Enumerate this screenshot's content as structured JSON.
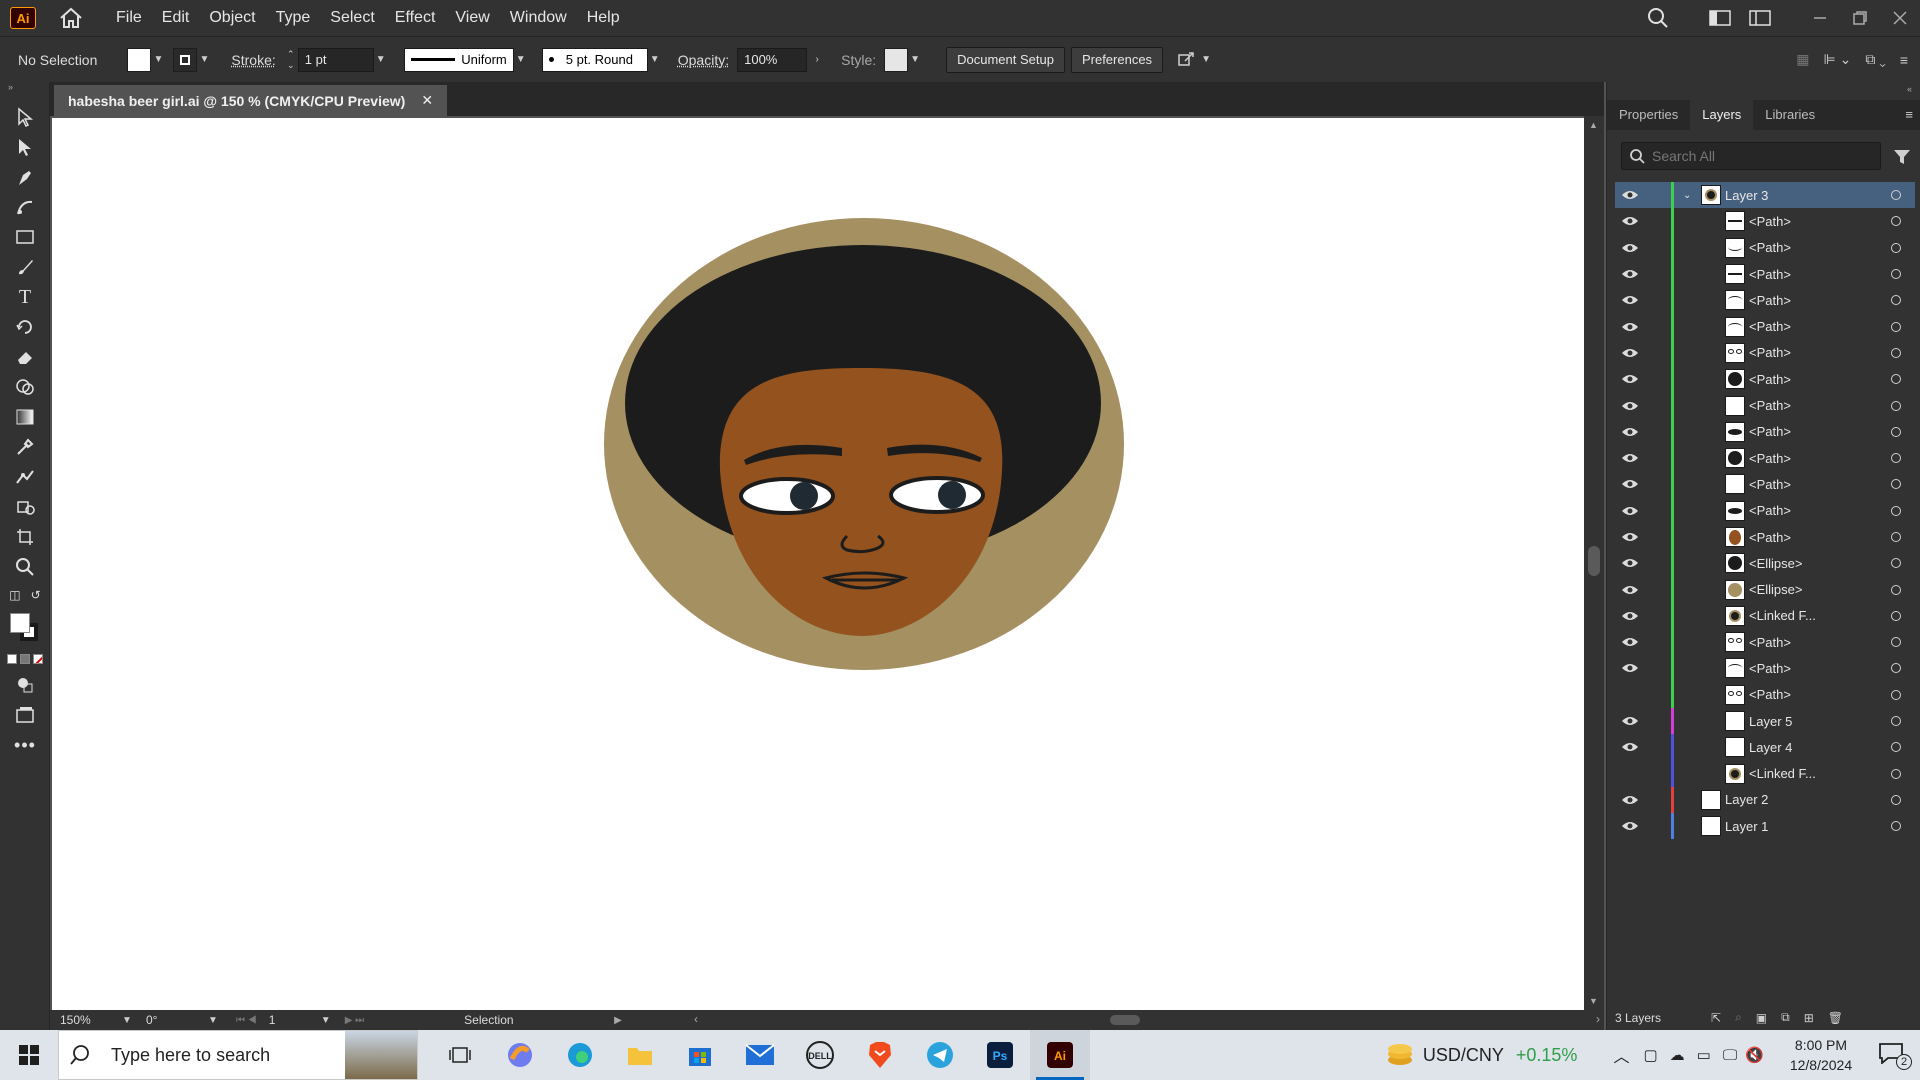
{
  "app": {
    "logo_text": "Ai",
    "accent": "#ff9a00"
  },
  "menu": {
    "items": [
      "File",
      "Edit",
      "Object",
      "Type",
      "Select",
      "Effect",
      "View",
      "Window",
      "Help"
    ]
  },
  "control": {
    "selection": "No Selection",
    "stroke_label": "Stroke:",
    "stroke_weight": "1 pt",
    "stroke_profile": "Uniform",
    "brush": "5 pt. Round",
    "opacity_label": "Opacity:",
    "opacity": "100%",
    "style_label": "Style:",
    "document_setup": "Document Setup",
    "preferences": "Preferences"
  },
  "document": {
    "tab_title": "habesha beer girl.ai @ 150 % (CMYK/CPU Preview)",
    "close": "✕"
  },
  "status": {
    "zoom": "150%",
    "rotation": "0°",
    "artboard": "1",
    "tool": "Selection"
  },
  "panel": {
    "tabs": [
      "Properties",
      "Layers",
      "Libraries"
    ],
    "active_tab": "Layers",
    "search_placeholder": "Search All",
    "footer_count": "3 Layers",
    "layers": [
      {
        "name": "Layer 3",
        "level": 0,
        "expanded": true,
        "selected": true,
        "color": "#3ed04a",
        "thumb": "face",
        "visible": true
      },
      {
        "name": "<Path>",
        "level": 1,
        "color": "#3ed04a",
        "thumb": "line",
        "visible": true
      },
      {
        "name": "<Path>",
        "level": 1,
        "color": "#3ed04a",
        "thumb": "curve",
        "visible": true
      },
      {
        "name": "<Path>",
        "level": 1,
        "color": "#3ed04a",
        "thumb": "line",
        "visible": true
      },
      {
        "name": "<Path>",
        "level": 1,
        "color": "#3ed04a",
        "thumb": "arc",
        "visible": true
      },
      {
        "name": "<Path>",
        "level": 1,
        "color": "#3ed04a",
        "thumb": "arc",
        "visible": true
      },
      {
        "name": "<Path>",
        "level": 1,
        "color": "#3ed04a",
        "thumb": "eyes",
        "visible": true
      },
      {
        "name": "<Path>",
        "level": 1,
        "color": "#3ed04a",
        "thumb": "dark",
        "visible": true
      },
      {
        "name": "<Path>",
        "level": 1,
        "color": "#3ed04a",
        "thumb": "blank",
        "visible": true
      },
      {
        "name": "<Path>",
        "level": 1,
        "color": "#3ed04a",
        "thumb": "oval",
        "visible": true
      },
      {
        "name": "<Path>",
        "level": 1,
        "color": "#3ed04a",
        "thumb": "dark",
        "visible": true
      },
      {
        "name": "<Path>",
        "level": 1,
        "color": "#3ed04a",
        "thumb": "blank",
        "visible": true
      },
      {
        "name": "<Path>",
        "level": 1,
        "color": "#3ed04a",
        "thumb": "oval",
        "visible": true
      },
      {
        "name": "<Path>",
        "level": 1,
        "color": "#3ed04a",
        "thumb": "brown",
        "visible": true
      },
      {
        "name": "<Ellipse>",
        "level": 1,
        "color": "#3ed04a",
        "thumb": "dark",
        "visible": true
      },
      {
        "name": "<Ellipse>",
        "level": 1,
        "color": "#3ed04a",
        "thumb": "tan",
        "visible": true
      },
      {
        "name": "<Linked F...",
        "level": 1,
        "color": "#3ed04a",
        "thumb": "face",
        "visible": true
      },
      {
        "name": "<Path>",
        "level": 1,
        "color": "#3ed04a",
        "thumb": "eyes",
        "visible": true
      },
      {
        "name": "<Path>",
        "level": 1,
        "color": "#3ed04a",
        "thumb": "arc",
        "visible": true
      },
      {
        "name": "<Path>",
        "level": 1,
        "color": "#3ed04a",
        "thumb": "eyes",
        "visible": false
      },
      {
        "name": "Layer 5",
        "level": 1,
        "color": "#d43ed4",
        "thumb": "blank",
        "visible": true
      },
      {
        "name": "Layer 4",
        "level": 1,
        "color": "#5050e0",
        "thumb": "blank",
        "visible": true
      },
      {
        "name": "<Linked F...",
        "level": 1,
        "color": "#5050e0",
        "thumb": "face",
        "visible": false
      },
      {
        "name": "Layer 2",
        "level": 0,
        "color": "#e04040",
        "thumb": "blank",
        "visible": true
      },
      {
        "name": "Layer 1",
        "level": 0,
        "color": "#4f7fe0",
        "thumb": "blank",
        "visible": true
      }
    ]
  },
  "artwork": {
    "colors": {
      "background": "#a59062",
      "hair": "#1c1c1c",
      "skin": "#93521e",
      "eye_white": "#ffffff",
      "pupil": "#1f2a33"
    }
  },
  "taskbar": {
    "search_placeholder": "Type here to search",
    "ticker": "USD/CNY",
    "ticker_change": "+0.15%",
    "time": "8:00 PM",
    "date": "12/8/2024",
    "notification_count": "2"
  }
}
